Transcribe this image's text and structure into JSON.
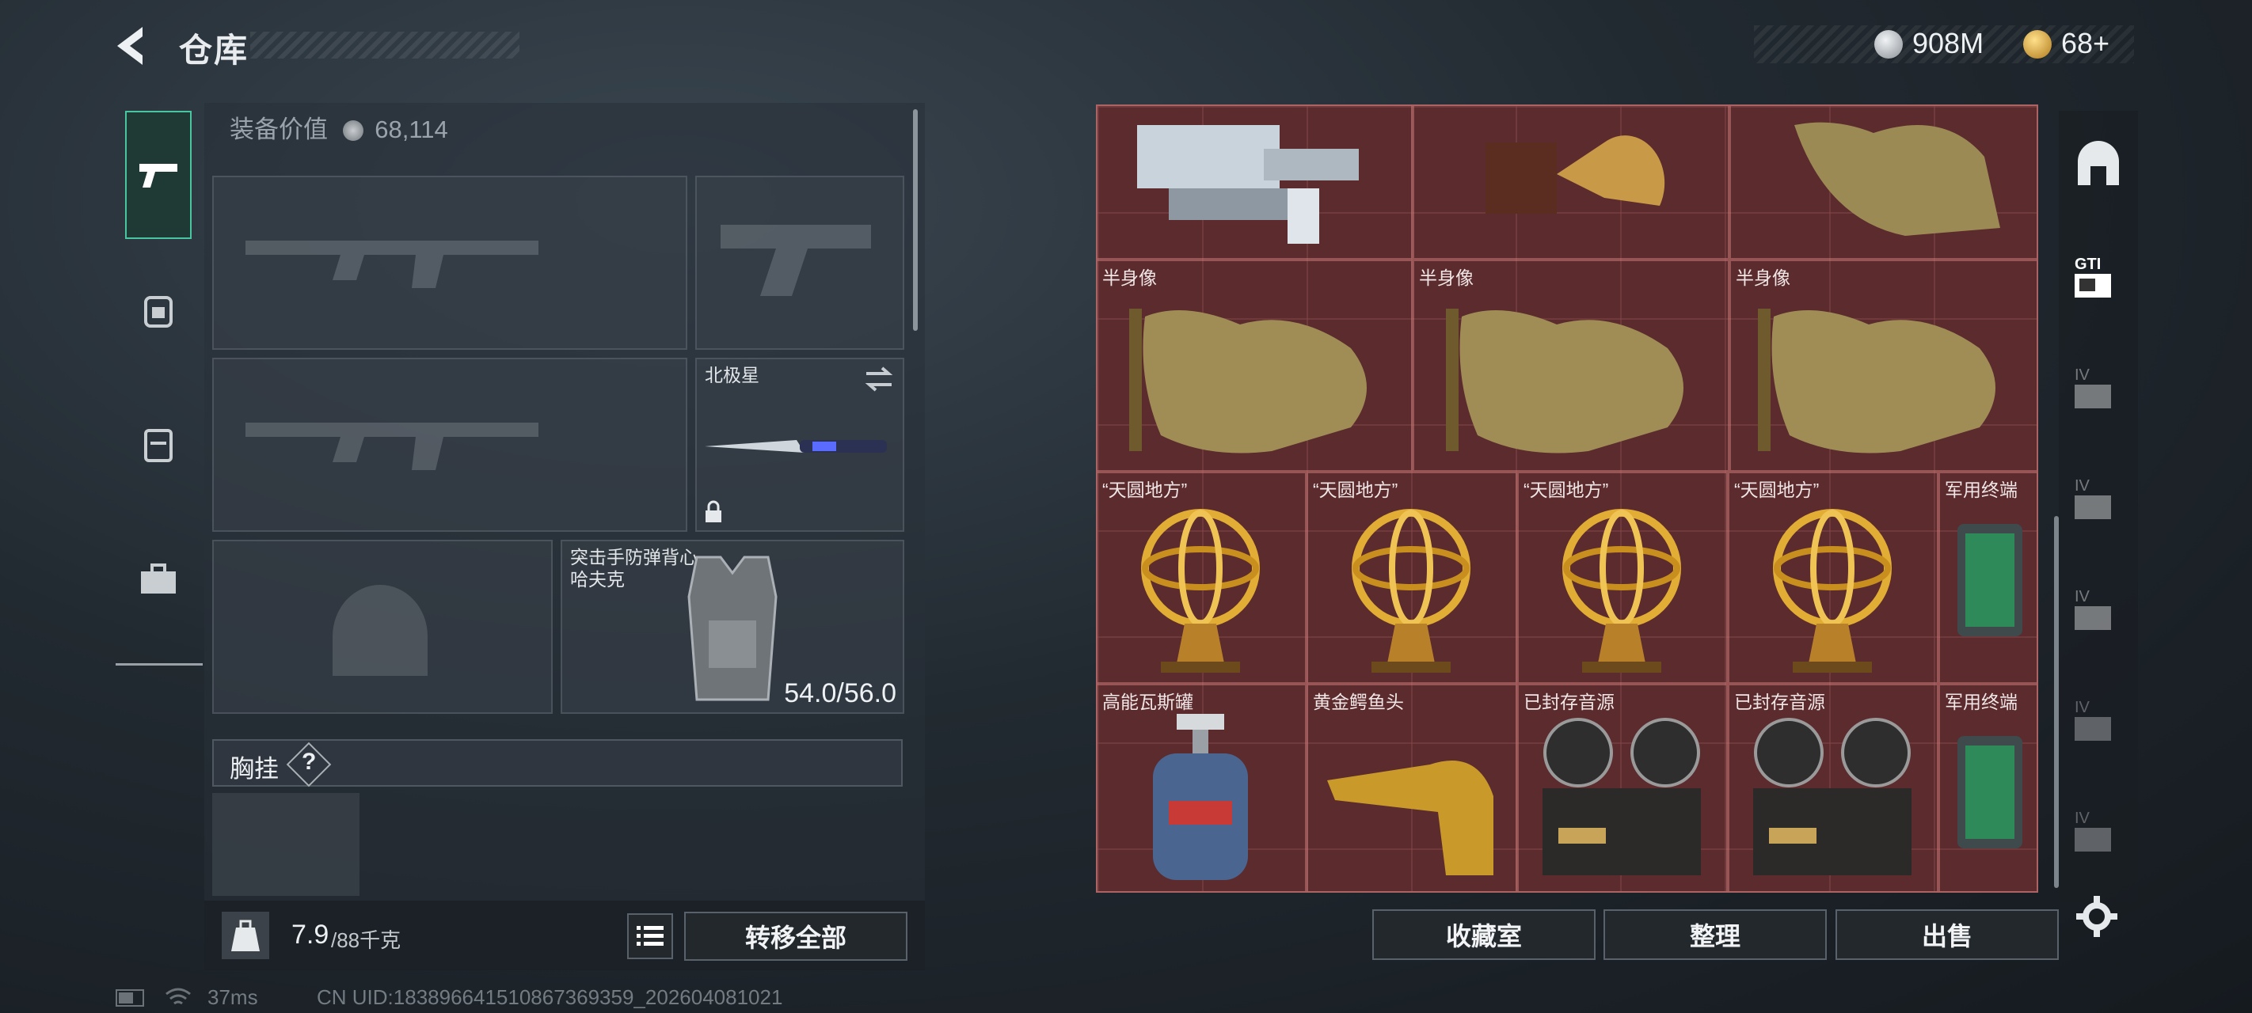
{
  "header": {
    "title": "仓库"
  },
  "currency": [
    {
      "icon": "silver-coin-icon",
      "value": "908M",
      "color": "#c8ccd0"
    },
    {
      "icon": "gold-coin-icon",
      "value": "68+",
      "color": "#e0b14a"
    }
  ],
  "left_rail": [
    "gun-icon",
    "backpack-icon",
    "vest-icon",
    "toolbox-icon"
  ],
  "equipment": {
    "value_label": "装备价值",
    "value": "68,114",
    "melee_name": "北极星",
    "armor_name": "突击手防弹背心\n哈夫克",
    "armor_durability": "54.0/56.0",
    "chest_rig_label": "胸挂",
    "help": "?",
    "weight": "7.9",
    "weight_cap": "/88千克",
    "transfer_all": "转移全部"
  },
  "stash": {
    "items": [
      {
        "label": "半身像"
      },
      {
        "label": "半身像"
      },
      {
        "label": "半身像"
      },
      {
        "label": "“天圆地方”"
      },
      {
        "label": "“天圆地方”"
      },
      {
        "label": "“天圆地方”"
      },
      {
        "label": "“天圆地方”"
      },
      {
        "label": "军用终端"
      },
      {
        "label": "高能瓦斯罐"
      },
      {
        "label": "黄金鳄鱼头"
      },
      {
        "label": "已封存音源"
      },
      {
        "label": "已封存音源"
      },
      {
        "label": "军用终端"
      }
    ],
    "buttons": {
      "collection": "收藏室",
      "organize": "整理",
      "sell": "出售"
    }
  },
  "right_rail": [
    "stash-tab-icon",
    "gti-tab-icon",
    "iv-tab-icon",
    "iv-tab-icon",
    "iv-tab-icon",
    "iv-tab-icon",
    "iv-tab-icon",
    "settings-icon"
  ],
  "status_bar": {
    "ping": "37ms",
    "uid": "CN UID:1838966415108673693​59_202604081021"
  }
}
